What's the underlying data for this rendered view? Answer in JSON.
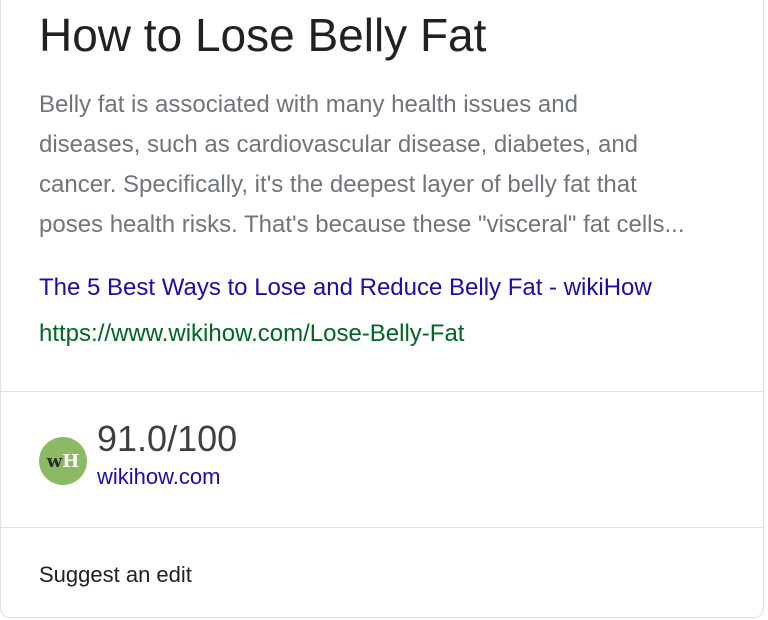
{
  "card": {
    "title": "How to Lose Belly Fat",
    "snippet_lines": [
      "Belly fat is associated with many health issues and",
      "diseases, such as cardiovascular disease, diabetes, and",
      "cancer. Specifically, it's the deepest layer of belly fat that",
      "poses health risks. That's because these \"visceral\" fat cells..."
    ],
    "result_title": "The 5 Best Ways to Lose and Reduce Belly Fat - wikiHow",
    "result_url": "https://www.wikihow.com/Lose-Belly-Fat"
  },
  "source": {
    "logo_letters": {
      "w": "w",
      "h": "H"
    },
    "logo_icon": "wikihow-logo-icon",
    "score": "91.0/100",
    "site": "wikihow.com"
  },
  "footer": {
    "suggest_label": "Suggest an edit"
  },
  "colors": {
    "link": "#1a0dab",
    "url": "#006621",
    "logo_bg": "#8cba64",
    "divider": "#dfe1e5"
  }
}
